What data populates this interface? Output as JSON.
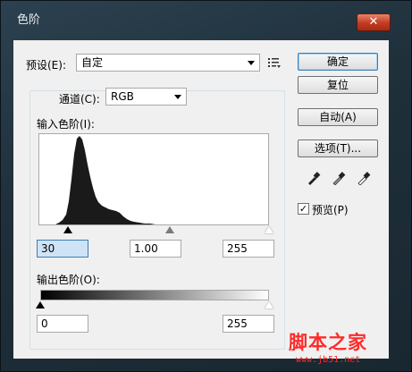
{
  "window": {
    "title": "色阶",
    "close_glyph": "✕"
  },
  "preset": {
    "label": "预设(E):",
    "value": "自定",
    "menu_icon": "list-menu-icon"
  },
  "channel": {
    "label": "通道(C):",
    "value": "RGB"
  },
  "input_levels": {
    "label": "输入色阶(I):",
    "black": "30",
    "gamma": "1.00",
    "white": "255"
  },
  "output_levels": {
    "label": "输出色阶(O):",
    "black": "0",
    "white": "255"
  },
  "buttons": {
    "ok": "确定",
    "reset": "复位",
    "auto": "自动(A)",
    "options": "选项(T)..."
  },
  "eyedroppers": [
    "black-eyedropper-icon",
    "gray-eyedropper-icon",
    "white-eyedropper-icon"
  ],
  "preview": {
    "label": "预览(P)",
    "checked": true,
    "check_glyph": "✓"
  },
  "watermark": {
    "text": "脚本之家",
    "url": "www.jb51.net"
  },
  "colors": {
    "accent": "#3c7fb1",
    "close": "#c23b22",
    "watermark": "#ff2b2b"
  }
}
